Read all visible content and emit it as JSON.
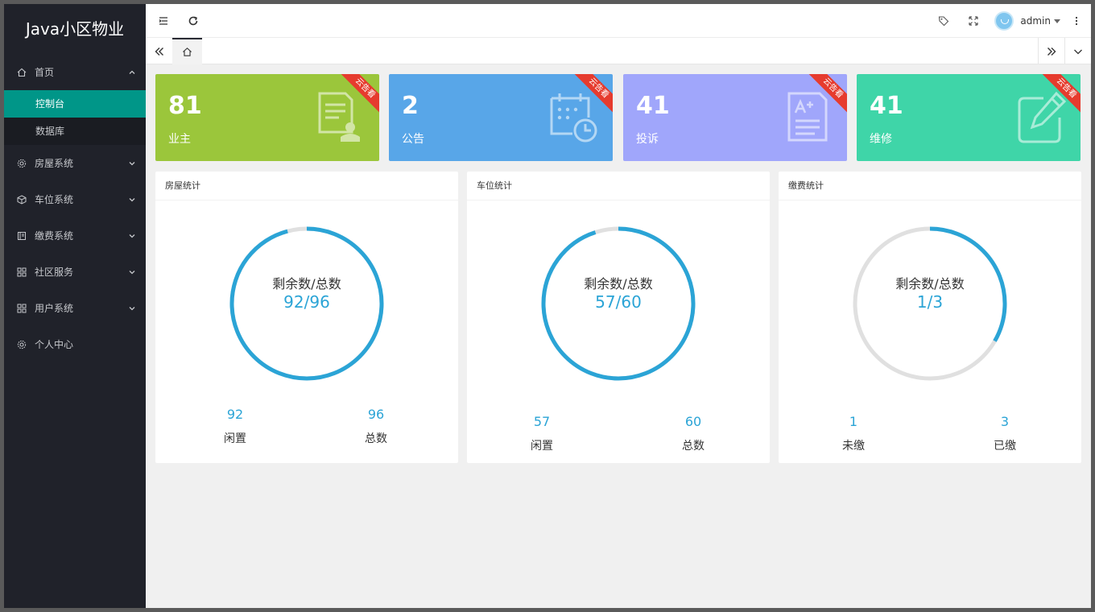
{
  "app": {
    "title": "Java小区物业"
  },
  "sidebar": {
    "items": [
      {
        "label": "首页",
        "expanded": true,
        "icon": "home-icon",
        "children": [
          {
            "label": "控制台",
            "active": true
          },
          {
            "label": "数据库"
          }
        ]
      },
      {
        "label": "房屋系统",
        "icon": "gear-icon"
      },
      {
        "label": "车位系统",
        "icon": "cube-icon"
      },
      {
        "label": "缴费系统",
        "icon": "book-icon"
      },
      {
        "label": "社区服务",
        "icon": "apps-icon"
      },
      {
        "label": "用户系统",
        "icon": "apps-icon"
      },
      {
        "label": "个人中心",
        "icon": "gear-icon"
      }
    ]
  },
  "header": {
    "user": "admin"
  },
  "colors": {
    "green": "#9bc63b",
    "blue": "#58a6e8",
    "lavender": "#a0a6fb",
    "teal": "#3fd5a8",
    "accent": "#009688",
    "ring": "#2ba4d6"
  },
  "cards": [
    {
      "value": "81",
      "label": "业主",
      "ribbon": "云告看",
      "icon": "document-user-icon",
      "color": "#9bc63b"
    },
    {
      "value": "2",
      "label": "公告",
      "ribbon": "云告看",
      "icon": "calendar-clock-icon",
      "color": "#58a6e8"
    },
    {
      "value": "41",
      "label": "投诉",
      "ribbon": "云告看",
      "icon": "document-grade-icon",
      "color": "#a0a6fb"
    },
    {
      "value": "41",
      "label": "维修",
      "ribbon": "云告看",
      "icon": "edit-icon",
      "color": "#3fd5a8"
    }
  ],
  "panels": [
    {
      "title": "房屋统计",
      "center_label": "剩余数/总数",
      "center_value": "92/96",
      "remaining": 92,
      "total": 96,
      "left_value": "92",
      "left_label": "闲置",
      "right_value": "96",
      "right_label": "总数"
    },
    {
      "title": "车位统计",
      "center_label": "剩余数/总数",
      "center_value": "57/60",
      "remaining": 57,
      "total": 60,
      "left_value": "57",
      "left_label": "闲置",
      "right_value": "60",
      "right_label": "总数"
    },
    {
      "title": "缴费统计",
      "center_label": "剩余数/总数",
      "center_value": "1/3",
      "remaining": 1,
      "total": 3,
      "left_value": "1",
      "left_label": "未缴",
      "right_value": "3",
      "right_label": "已缴"
    }
  ]
}
